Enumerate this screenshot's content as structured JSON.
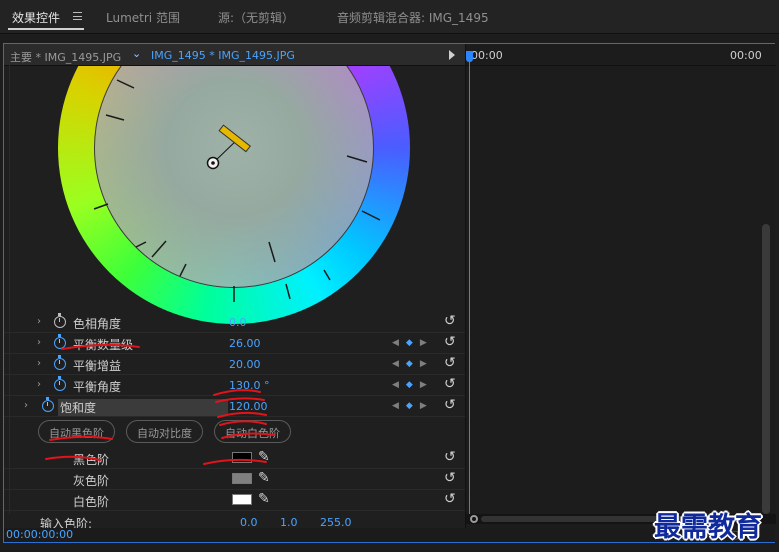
{
  "tabs": [
    {
      "label": "效果控件",
      "active": true
    },
    {
      "label": "Lumetri 范围",
      "active": false
    },
    {
      "label": "源:（无剪辑）",
      "active": false
    },
    {
      "label": "音频剪辑混合器: IMG_1495",
      "active": false
    }
  ],
  "clip_header": {
    "master": "主要 * IMG_1495.JPG",
    "sequence": "IMG_1495 * IMG_1495.JPG"
  },
  "timeline": {
    "time_start": "00:00",
    "time_end": "00:00"
  },
  "properties": [
    {
      "label": "色相角度",
      "value": "0.0",
      "keyframed": false
    },
    {
      "label": "平衡数量级",
      "value": "26.00",
      "keyframed": true
    },
    {
      "label": "平衡增益",
      "value": "20.00",
      "keyframed": true
    },
    {
      "label": "平衡角度",
      "value": "130.0 °",
      "keyframed": true
    },
    {
      "label": "饱和度",
      "value": "120.00",
      "keyframed": true,
      "selected": true
    }
  ],
  "auto_buttons": [
    "自动黑色阶",
    "自动对比度",
    "自动白色阶"
  ],
  "levels": [
    {
      "label": "黑色阶",
      "color": "#000000"
    },
    {
      "label": "灰色阶",
      "color": "#808080"
    },
    {
      "label": "白色阶",
      "color": "#ffffff"
    }
  ],
  "input_levels": {
    "label": "输入色阶:",
    "values": [
      "0.0",
      "1.0",
      "255.0"
    ]
  },
  "timecode": "00:00:00:00",
  "watermark": "最需教育",
  "accent_color": "#4aa3ff",
  "annotation_color": "#e0141a"
}
